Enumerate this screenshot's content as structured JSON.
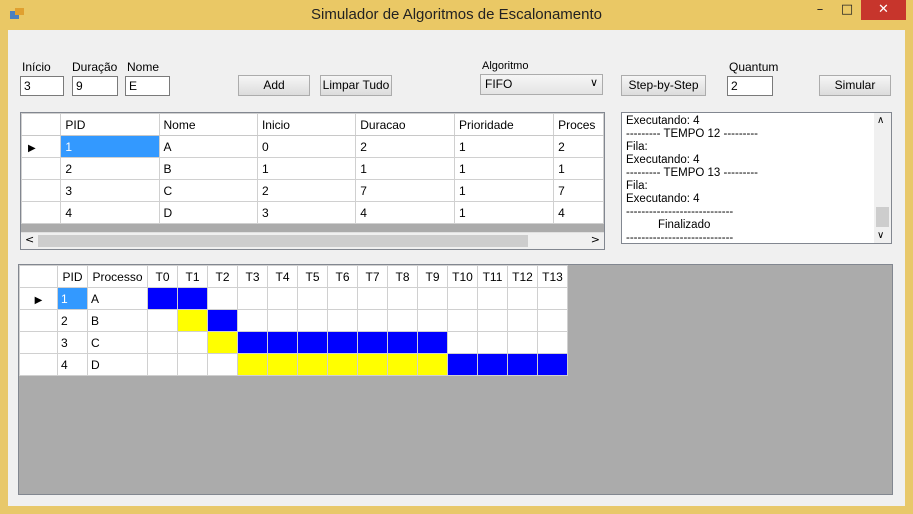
{
  "window": {
    "title": "Simulador de Algoritmos de Escalonamento"
  },
  "form": {
    "inicio_label": "Início",
    "inicio_value": "3",
    "duracao_label": "Duração",
    "duracao_value": "9",
    "nome_label": "Nome",
    "nome_value": "E",
    "add_label": "Add",
    "limpar_label": "Limpar Tudo",
    "algoritmo_label": "Algoritmo",
    "algoritmo_value": "FIFO",
    "step_label": "Step-by-Step",
    "quantum_label": "Quantum",
    "quantum_value": "2",
    "simular_label": "Simular"
  },
  "process_table": {
    "columns": [
      "PID",
      "Nome",
      "Inicio",
      "Duracao",
      "Prioridade",
      "Proces"
    ],
    "rows": [
      [
        "1",
        "A",
        "0",
        "2",
        "1",
        "2"
      ],
      [
        "2",
        "B",
        "1",
        "1",
        "1",
        "1"
      ],
      [
        "3",
        "C",
        "2",
        "7",
        "1",
        "7"
      ],
      [
        "4",
        "D",
        "3",
        "4",
        "1",
        "4"
      ]
    ]
  },
  "log": {
    "lines": [
      "Executando: 4",
      "--------- TEMPO 12 ---------",
      "Fila:",
      "Executando: 4",
      "--------- TEMPO 13 ---------",
      "Fila:",
      "Executando: 4",
      "----------------------------",
      "          Finalizado",
      "----------------------------"
    ]
  },
  "gantt": {
    "columns": [
      "PID",
      "Processo",
      "T0",
      "T1",
      "T2",
      "T3",
      "T4",
      "T5",
      "T6",
      "T7",
      "T8",
      "T9",
      "T10",
      "T11",
      "T12",
      "T13"
    ],
    "rows": [
      {
        "pid": "1",
        "name": "A",
        "cells": [
          "B",
          "B",
          "",
          "",
          "",
          "",
          "",
          "",
          "",
          "",
          "",
          "",
          "",
          ""
        ]
      },
      {
        "pid": "2",
        "name": "B",
        "cells": [
          "",
          "Y",
          "B",
          "",
          "",
          "",
          "",
          "",
          "",
          "",
          "",
          "",
          "",
          ""
        ]
      },
      {
        "pid": "3",
        "name": "C",
        "cells": [
          "",
          "",
          "Y",
          "B",
          "B",
          "B",
          "B",
          "B",
          "B",
          "B",
          "",
          "",
          "",
          ""
        ]
      },
      {
        "pid": "4",
        "name": "D",
        "cells": [
          "",
          "",
          "",
          "Y",
          "Y",
          "Y",
          "Y",
          "Y",
          "Y",
          "Y",
          "B",
          "B",
          "B",
          "B"
        ]
      }
    ],
    "colors": {
      "B": "#0000ff",
      "Y": "#ffff00"
    }
  }
}
